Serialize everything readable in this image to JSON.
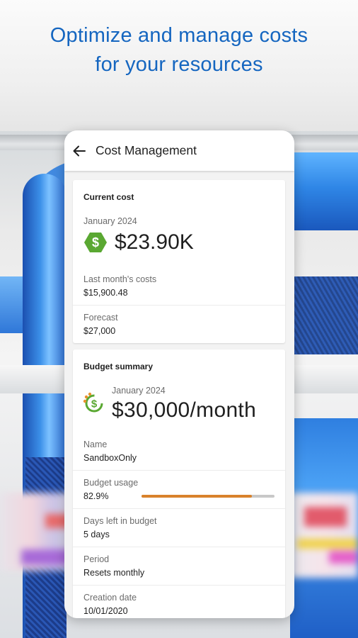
{
  "headline": {
    "line1": "Optimize and manage costs",
    "line2": "for your resources"
  },
  "appbar": {
    "title": "Cost Management",
    "back_icon": "arrow-left-icon"
  },
  "current_cost": {
    "heading": "Current cost",
    "period": "January 2024",
    "amount": "$23.90K",
    "icon": "dollar-badge-icon",
    "fields": [
      {
        "label": "Last month's costs",
        "value": "$15,900.48"
      },
      {
        "label": "Forecast",
        "value": "$27,000"
      }
    ]
  },
  "budget_summary": {
    "heading": "Budget summary",
    "period": "January 2024",
    "amount": "$30,000/month",
    "icon": "dollar-refresh-icon",
    "name_label": "Name",
    "name_value": "SandboxOnly",
    "usage_label": "Budget usage",
    "usage_value": "82.9%",
    "usage_fraction": 0.829,
    "days_label": "Days left in budget",
    "days_value": "5 days",
    "period_label": "Period",
    "period_value": "Resets monthly",
    "created_label": "Creation date",
    "created_value": "10/01/2020"
  },
  "colors": {
    "headline": "#1566c0",
    "accent_green": "#5aa832",
    "progress": "#d9822b"
  }
}
